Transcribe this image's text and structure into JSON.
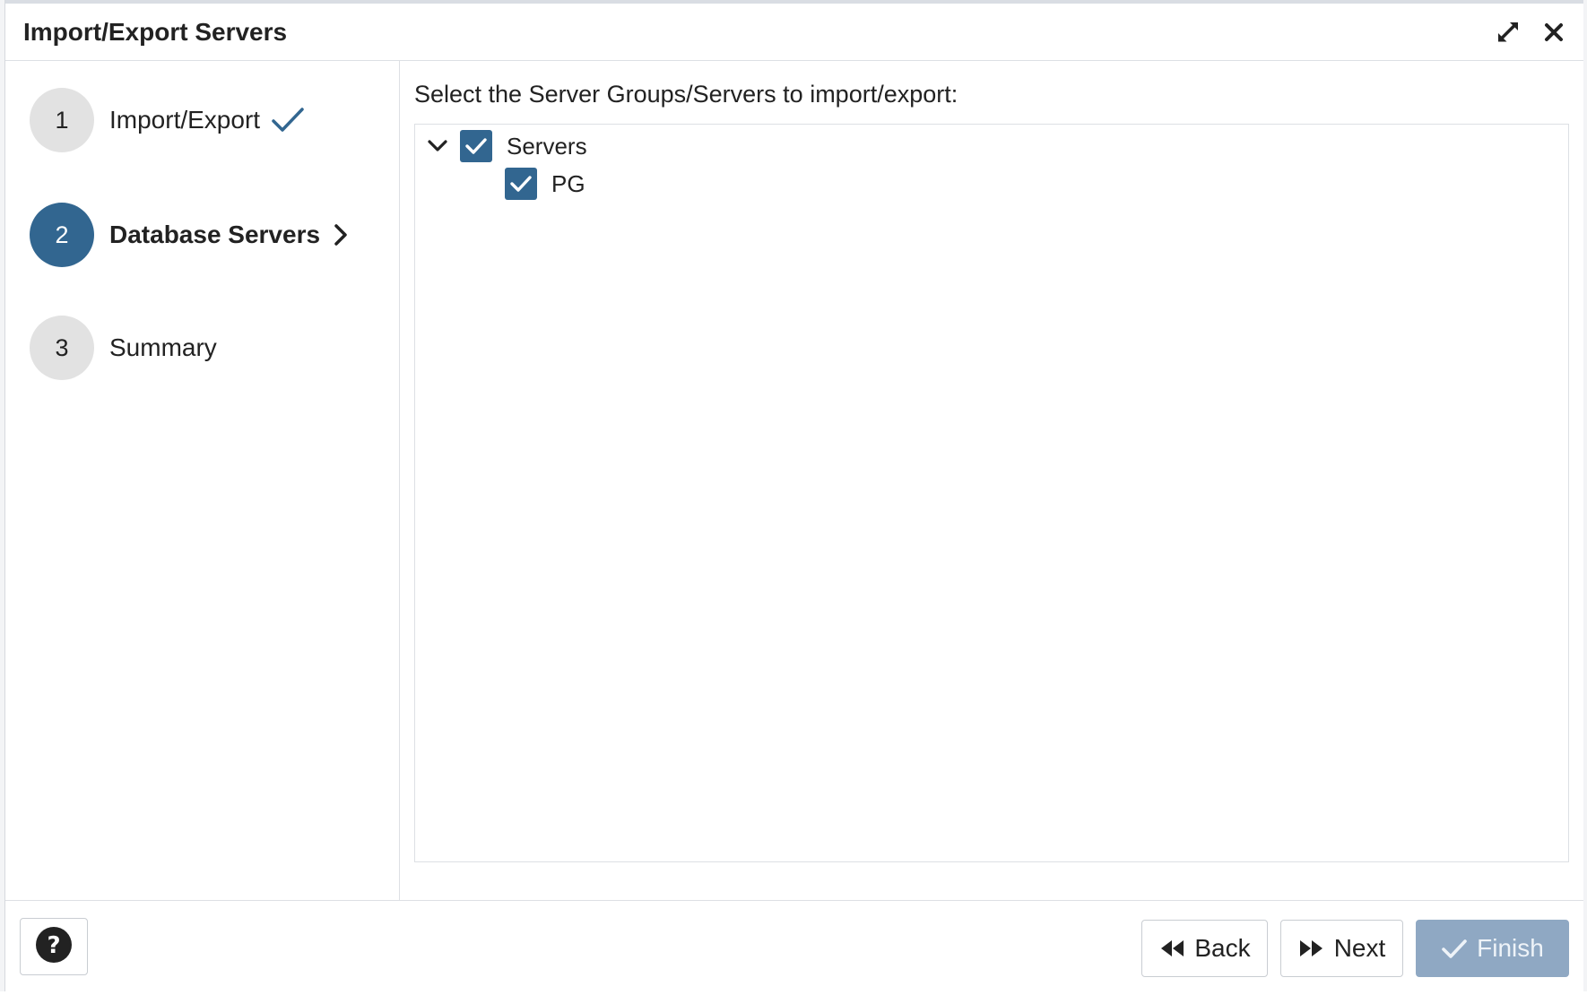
{
  "dialog": {
    "title": "Import/Export Servers",
    "icons": {
      "maximize": "expand-icon",
      "close": "close-icon"
    }
  },
  "steps": [
    {
      "number": "1",
      "label": "Import/Export",
      "state": "completed",
      "mark_icon": "checkmark-icon"
    },
    {
      "number": "2",
      "label": "Database Servers",
      "state": "active",
      "mark_icon": "chevron-right-icon"
    },
    {
      "number": "3",
      "label": "Summary",
      "state": "pending"
    }
  ],
  "content": {
    "instruction": "Select the Server Groups/Servers to import/export:",
    "tree": {
      "group": {
        "label": "Servers",
        "checked": true,
        "expanded": true
      },
      "children": [
        {
          "label": "PG",
          "checked": true
        }
      ]
    }
  },
  "footer": {
    "help_icon": "question-circle-icon",
    "back_label": "Back",
    "next_label": "Next",
    "finish_label": "Finish",
    "finish_enabled": false
  },
  "colors": {
    "accent": "#326690",
    "finish_disabled": "#8fa8c3",
    "step_inactive": "#e2e2e2"
  }
}
